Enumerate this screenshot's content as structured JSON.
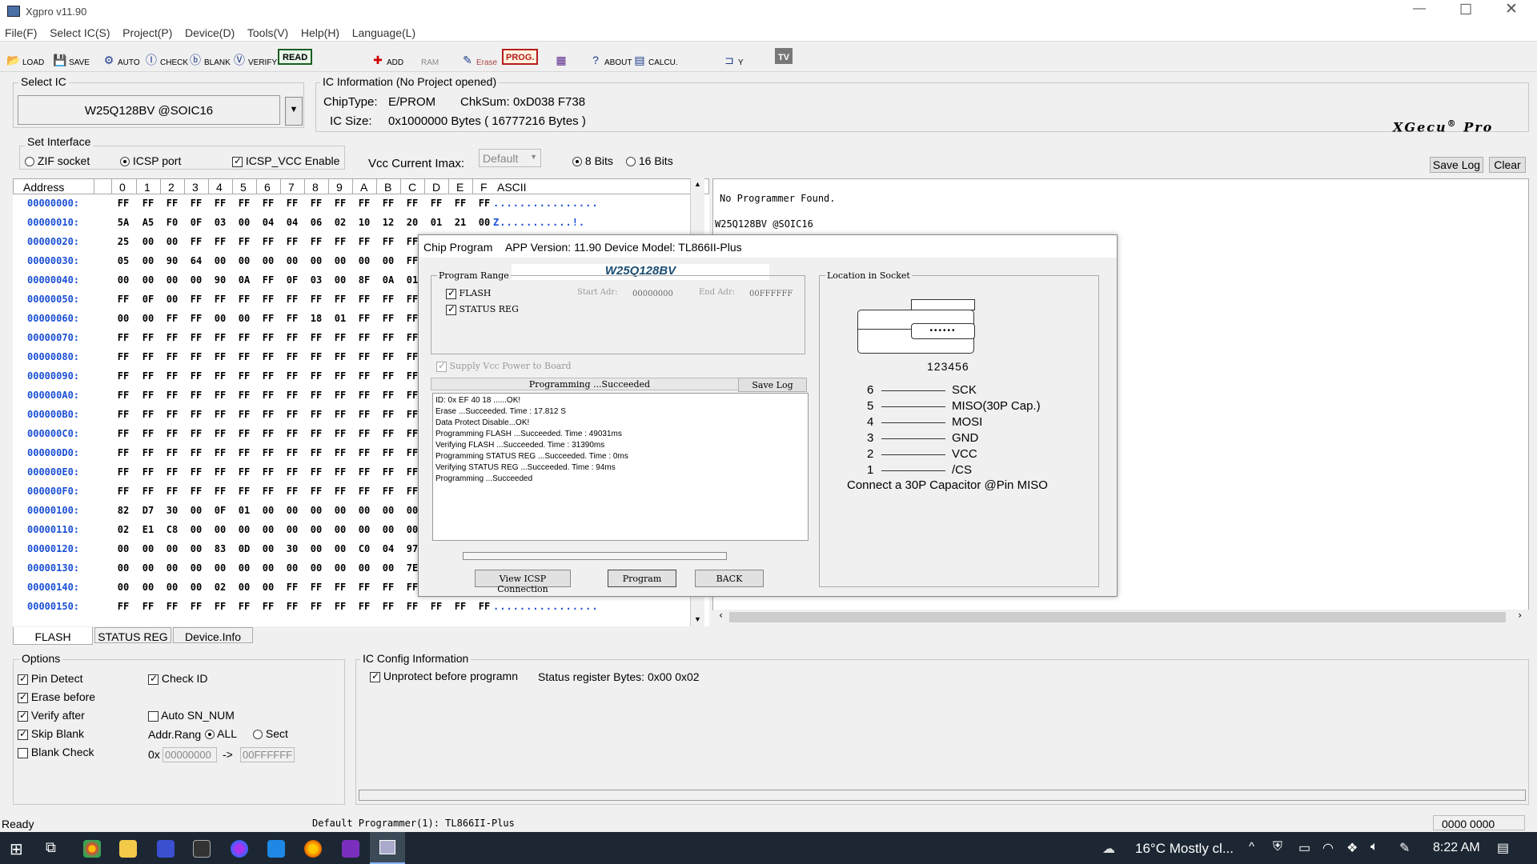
{
  "window": {
    "title": "Xgpro v11.90"
  },
  "menu": [
    "File(F)",
    "Select IC(S)",
    "Project(P)",
    "Device(D)",
    "Tools(V)",
    "Help(H)",
    "Language(L)"
  ],
  "toolbar": {
    "load": "LOAD",
    "save": "SAVE",
    "auto": "AUTO",
    "check": "CHECK",
    "blank": "BLANK",
    "verify": "VERIFY",
    "read": "READ",
    "add": "ADD",
    "ram": "RAM",
    "erase": "Erase",
    "prog": "PROG.",
    "about": "ABOUT",
    "calcu": "CALCU.",
    "tv": "TV",
    "y": "Y"
  },
  "select_ic": {
    "label": "Select IC",
    "value": "W25Q128BV @SOIC16"
  },
  "ic_info": {
    "label": "IC Information (No Project opened)",
    "chiptype_label": "ChipType:",
    "chiptype": "E/PROM",
    "chksum_label": "ChkSum:",
    "chksum": "0xD038 F738",
    "size_label": "IC Size:",
    "size": "0x1000000 Bytes ( 16777216 Bytes )",
    "brand": "XGecu",
    "brand_reg": "®",
    "brand_suffix": "Pro"
  },
  "interface": {
    "label": "Set Interface",
    "zif": "ZIF socket",
    "icsp": "ICSP port",
    "icsp_vcc": "ICSP_VCC Enable",
    "vcc_imax": "Vcc Current Imax:",
    "vcc_default": "Default",
    "bits8": "8 Bits",
    "bits16": "16 Bits",
    "save_log": "Save Log",
    "clear": "Clear"
  },
  "hex": {
    "header": [
      "Address",
      "0",
      "1",
      "2",
      "3",
      "4",
      "5",
      "6",
      "7",
      "8",
      "9",
      "A",
      "B",
      "C",
      "D",
      "E",
      "F",
      "ASCII"
    ],
    "rows": [
      {
        "a": "00000000:",
        "b": [
          "FF",
          "FF",
          "FF",
          "FF",
          "FF",
          "FF",
          "FF",
          "FF",
          "FF",
          "FF",
          "FF",
          "FF",
          "FF",
          "FF",
          "FF",
          "FF"
        ],
        "s": "................"
      },
      {
        "a": "00000010:",
        "b": [
          "5A",
          "A5",
          "F0",
          "0F",
          "03",
          "00",
          "04",
          "04",
          "06",
          "02",
          "10",
          "12",
          "20",
          "01",
          "21",
          "00"
        ],
        "s": "Z...........!."
      },
      {
        "a": "00000020:",
        "b": [
          "25",
          "00",
          "00",
          "FF",
          "FF",
          "FF",
          "FF",
          "FF",
          "FF",
          "FF",
          "FF",
          "FF",
          "FF",
          "",
          "",
          ""
        ],
        "s": ""
      },
      {
        "a": "00000030:",
        "b": [
          "05",
          "00",
          "90",
          "64",
          "00",
          "00",
          "00",
          "00",
          "00",
          "00",
          "00",
          "00",
          "FF",
          "",
          "",
          ""
        ],
        "s": ""
      },
      {
        "a": "00000040:",
        "b": [
          "00",
          "00",
          "00",
          "00",
          "90",
          "0A",
          "FF",
          "0F",
          "03",
          "00",
          "8F",
          "0A",
          "01",
          "",
          "",
          ""
        ],
        "s": ""
      },
      {
        "a": "00000050:",
        "b": [
          "FF",
          "0F",
          "00",
          "FF",
          "FF",
          "FF",
          "FF",
          "FF",
          "FF",
          "FF",
          "FF",
          "FF",
          "FF",
          "",
          "",
          ""
        ],
        "s": ""
      },
      {
        "a": "00000060:",
        "b": [
          "00",
          "00",
          "FF",
          "FF",
          "00",
          "00",
          "FF",
          "FF",
          "18",
          "01",
          "FF",
          "FF",
          "FF",
          "",
          "",
          ""
        ],
        "s": ""
      },
      {
        "a": "00000070:",
        "b": [
          "FF",
          "FF",
          "FF",
          "FF",
          "FF",
          "FF",
          "FF",
          "FF",
          "FF",
          "FF",
          "FF",
          "FF",
          "FF",
          "",
          "",
          ""
        ],
        "s": ""
      },
      {
        "a": "00000080:",
        "b": [
          "FF",
          "FF",
          "FF",
          "FF",
          "FF",
          "FF",
          "FF",
          "FF",
          "FF",
          "FF",
          "FF",
          "FF",
          "FF",
          "",
          "",
          ""
        ],
        "s": ""
      },
      {
        "a": "00000090:",
        "b": [
          "FF",
          "FF",
          "FF",
          "FF",
          "FF",
          "FF",
          "FF",
          "FF",
          "FF",
          "FF",
          "FF",
          "FF",
          "FF",
          "",
          "",
          ""
        ],
        "s": ""
      },
      {
        "a": "000000A0:",
        "b": [
          "FF",
          "FF",
          "FF",
          "FF",
          "FF",
          "FF",
          "FF",
          "FF",
          "FF",
          "FF",
          "FF",
          "FF",
          "FF",
          "",
          "",
          ""
        ],
        "s": ""
      },
      {
        "a": "000000B0:",
        "b": [
          "FF",
          "FF",
          "FF",
          "FF",
          "FF",
          "FF",
          "FF",
          "FF",
          "FF",
          "FF",
          "FF",
          "FF",
          "FF",
          "",
          "",
          ""
        ],
        "s": ""
      },
      {
        "a": "000000C0:",
        "b": [
          "FF",
          "FF",
          "FF",
          "FF",
          "FF",
          "FF",
          "FF",
          "FF",
          "FF",
          "FF",
          "FF",
          "FF",
          "FF",
          "",
          "",
          ""
        ],
        "s": ""
      },
      {
        "a": "000000D0:",
        "b": [
          "FF",
          "FF",
          "FF",
          "FF",
          "FF",
          "FF",
          "FF",
          "FF",
          "FF",
          "FF",
          "FF",
          "FF",
          "FF",
          "",
          "",
          ""
        ],
        "s": ""
      },
      {
        "a": "000000E0:",
        "b": [
          "FF",
          "FF",
          "FF",
          "FF",
          "FF",
          "FF",
          "FF",
          "FF",
          "FF",
          "FF",
          "FF",
          "FF",
          "FF",
          "",
          "",
          ""
        ],
        "s": ""
      },
      {
        "a": "000000F0:",
        "b": [
          "FF",
          "FF",
          "FF",
          "FF",
          "FF",
          "FF",
          "FF",
          "FF",
          "FF",
          "FF",
          "FF",
          "FF",
          "FF",
          "",
          "",
          ""
        ],
        "s": ""
      },
      {
        "a": "00000100:",
        "b": [
          "82",
          "D7",
          "30",
          "00",
          "0F",
          "01",
          "00",
          "00",
          "00",
          "00",
          "00",
          "00",
          "00",
          "",
          "",
          ""
        ],
        "s": ""
      },
      {
        "a": "00000110:",
        "b": [
          "02",
          "E1",
          "C8",
          "00",
          "00",
          "00",
          "00",
          "00",
          "00",
          "00",
          "00",
          "00",
          "00",
          "",
          "",
          ""
        ],
        "s": ""
      },
      {
        "a": "00000120:",
        "b": [
          "00",
          "00",
          "00",
          "00",
          "83",
          "0D",
          "00",
          "30",
          "00",
          "00",
          "C0",
          "04",
          "97",
          "",
          "",
          ""
        ],
        "s": ""
      },
      {
        "a": "00000130:",
        "b": [
          "00",
          "00",
          "00",
          "00",
          "00",
          "00",
          "00",
          "00",
          "00",
          "00",
          "00",
          "00",
          "7E",
          "",
          "",
          ""
        ],
        "s": ""
      },
      {
        "a": "00000140:",
        "b": [
          "00",
          "00",
          "00",
          "00",
          "02",
          "00",
          "00",
          "FF",
          "FF",
          "FF",
          "FF",
          "FF",
          "FF",
          "",
          "",
          ""
        ],
        "s": ""
      },
      {
        "a": "00000150:",
        "b": [
          "FF",
          "FF",
          "FF",
          "FF",
          "FF",
          "FF",
          "FF",
          "FF",
          "FF",
          "FF",
          "FF",
          "FF",
          "FF",
          "FF",
          "FF",
          "FF"
        ],
        "s": "................"
      }
    ]
  },
  "tabs": [
    "FLASH",
    "STATUS REG",
    "Device.Info"
  ],
  "log": {
    "line1": "No Programmer Found.",
    "line2": "W25Q128BV @SOIC16"
  },
  "dialog": {
    "title": "Chip Program",
    "version": "APP Version: 11.90 Device Model: TL866II-Plus",
    "chip": "W25Q128BV",
    "range_label": "Program Range",
    "flash": "FLASH",
    "status_reg": "STATUS REG",
    "start_lbl": "Start Adr:",
    "start_val": "00000000",
    "end_lbl": "End Adr:",
    "end_val": "00FFFFFF",
    "supply": "Supply Vcc Power to Board",
    "status_text": "Programming  ...Succeeded",
    "save_log": "Save Log",
    "log": [
      "ID: 0x EF 40 18 ......OK!",
      "Erase  ...Succeeded. Time : 17.812 S",
      "Data Protect Disable...OK!",
      "Programming FLASH ...Succeeded. Time : 49031ms",
      "Verifying FLASH ...Succeeded. Time : 31390ms",
      "Programming STATUS REG ...Succeeded. Time : 0ms",
      "Verifying STATUS REG ...Succeeded. Time : 94ms",
      "Programming  ...Succeeded"
    ],
    "btn_view": "View ICSP Connection",
    "btn_program": "Program",
    "btn_back": "BACK",
    "location_label": "Location in Socket",
    "pin_numbers": "123456",
    "pins": [
      {
        "n": "6",
        "name": "SCK"
      },
      {
        "n": "5",
        "name": "MISO(30P Cap.)"
      },
      {
        "n": "4",
        "name": "MOSI"
      },
      {
        "n": "3",
        "name": "GND"
      },
      {
        "n": "2",
        "name": "VCC"
      },
      {
        "n": "1",
        "name": "/CS"
      }
    ],
    "note": "Connect a 30P Capacitor @Pin MISO"
  },
  "options": {
    "label": "Options",
    "pin_detect": "Pin Detect",
    "check_id": "Check ID",
    "erase_before": "Erase before",
    "verify_after": "Verify after",
    "auto_sn": "Auto SN_NUM",
    "skip_blank": "Skip Blank",
    "addr_range": "Addr.Rang",
    "all": "ALL",
    "sect": "Sect",
    "blank_check": "Blank Check",
    "ox": "0x",
    "from": "00000000",
    "arrow": "->",
    "to": "00FFFFFF"
  },
  "config": {
    "label": "IC Config Information",
    "unprotect": "Unprotect before programn",
    "status_bytes": "Status register Bytes: 0x00 0x02"
  },
  "statusbar": {
    "ready": "Ready",
    "programmer": "Default  Programmer(1): TL866II-Plus",
    "counter": "0000 0000"
  },
  "taskbar": {
    "weather": "16°C  Mostly cl...",
    "time": "8:22 AM"
  }
}
